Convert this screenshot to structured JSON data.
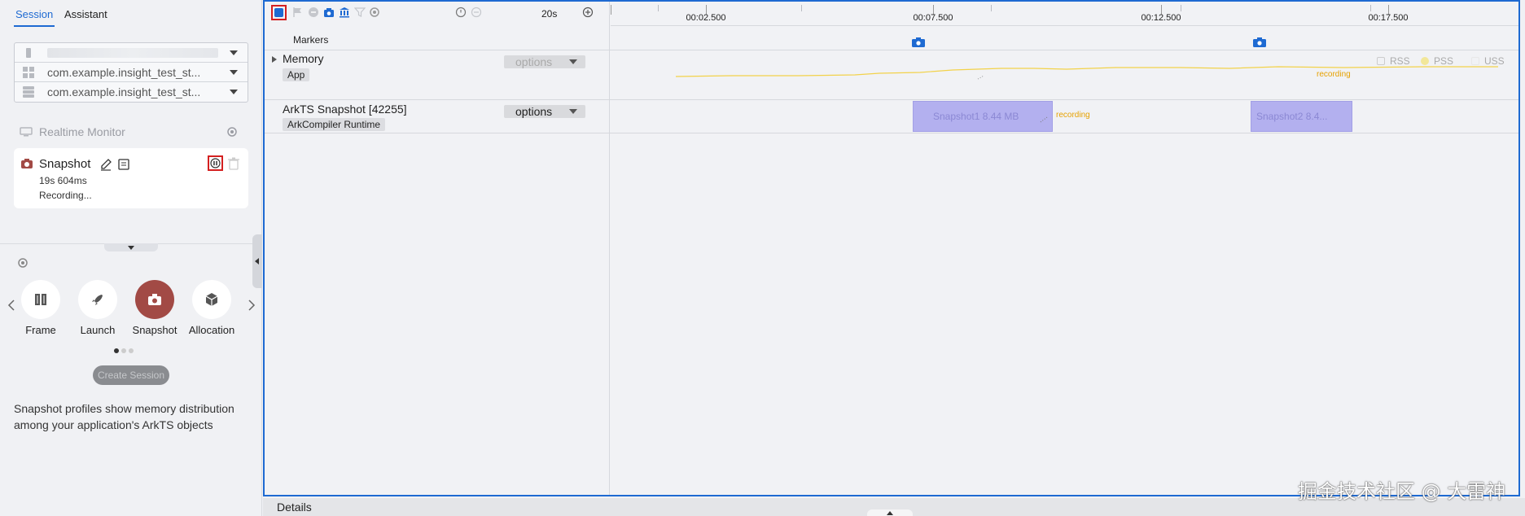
{
  "left_panel": {
    "tabs": [
      {
        "label": "Session",
        "active": true
      },
      {
        "label": "Assistant",
        "active": false
      }
    ],
    "selectors": [
      {
        "value": "",
        "icon": "device-icon"
      },
      {
        "value": "com.example.insight_test_st...",
        "icon": "app-grid-icon"
      },
      {
        "value": "com.example.insight_test_st...",
        "icon": "process-icon"
      }
    ],
    "realtime_monitor": {
      "label": "Realtime Monitor"
    },
    "session_card": {
      "title": "Snapshot",
      "duration": "19s 604ms",
      "status": "Recording..."
    },
    "profile_types": [
      {
        "label": "Frame",
        "icon": "frame-icon"
      },
      {
        "label": "Launch",
        "icon": "rocket-icon"
      },
      {
        "label": "Snapshot",
        "icon": "camera-icon",
        "selected": true
      },
      {
        "label": "Allocation",
        "icon": "cube-icon"
      }
    ],
    "create_button": "Create Session",
    "description": "Snapshot profiles show memory distribution among your application's ArkTS objects"
  },
  "toolbar": {
    "zoom": "20s"
  },
  "timeline": {
    "ticks": [
      "00:02.500",
      "00:07.500",
      "00:12.500",
      "00:17.500"
    ],
    "markers_label": "Markers"
  },
  "tracks": {
    "memory": {
      "name": "Memory",
      "tag": "App",
      "options_label": "options",
      "legend": [
        "RSS",
        "PSS",
        "USS"
      ],
      "recording_label": "recording"
    },
    "arkts": {
      "name": "ArkTS Snapshot [42255]",
      "tag": "ArkCompiler Runtime",
      "options_label": "options",
      "snapshots": [
        {
          "label": "Snapshot1 8.44 MB"
        },
        {
          "label": "Snapshot2 8.4..."
        }
      ],
      "recording_label": "recording"
    }
  },
  "details": {
    "label": "Details"
  },
  "watermark": "掘金技术社区 @ 大雷神",
  "colors": {
    "accent": "#1e6ad2",
    "snapshot_bar": "#b3b0ef",
    "memory_line": "#f2d24a",
    "recording_text": "#e6a100",
    "selected_profile": "#a24a45",
    "highlight_box": "#d42020"
  }
}
